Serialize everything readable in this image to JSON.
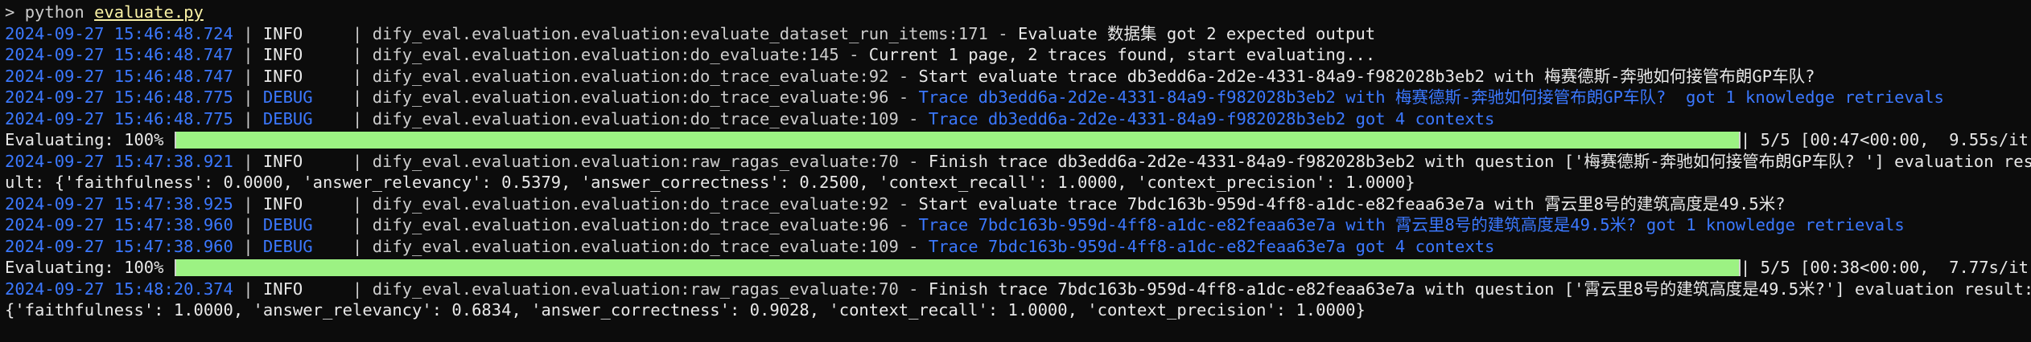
{
  "terminal": {
    "prompt": "> ",
    "command": "python",
    "argument": "evaluate.py"
  },
  "lines": [
    {
      "kind": "log",
      "ts": "2024-09-27 15:46:48.724",
      "level": "INFO",
      "loc": "dify_eval.evaluation.evaluation:evaluate_dataset_run_items:171",
      "msg": "Evaluate 数据集 got 2 expected output"
    },
    {
      "kind": "log",
      "ts": "2024-09-27 15:46:48.747",
      "level": "INFO",
      "loc": "dify_eval.evaluation.evaluation:do_evaluate:145",
      "msg": "Current 1 page, 2 traces found, start evaluating..."
    },
    {
      "kind": "log",
      "ts": "2024-09-27 15:46:48.747",
      "level": "INFO",
      "loc": "dify_eval.evaluation.evaluation:do_trace_evaluate:92",
      "msg": "Start evaluate trace db3edd6a-2d2e-4331-84a9-f982028b3eb2 with 梅赛德斯-奔驰如何接管布朗GP车队?"
    },
    {
      "kind": "log",
      "ts": "2024-09-27 15:46:48.775",
      "level": "DEBUG",
      "loc": "dify_eval.evaluation.evaluation:do_trace_evaluate:96",
      "msg": "Trace db3edd6a-2d2e-4331-84a9-f982028b3eb2 with 梅赛德斯-奔驰如何接管布朗GP车队?  got 1 knowledge retrievals"
    },
    {
      "kind": "log",
      "ts": "2024-09-27 15:46:48.775",
      "level": "DEBUG",
      "loc": "dify_eval.evaluation.evaluation:do_trace_evaluate:109",
      "msg": "Trace db3edd6a-2d2e-4331-84a9-f982028b3eb2 got 4 contexts"
    },
    {
      "kind": "progress",
      "label": "Evaluating: 100%",
      "fraction": 1.0,
      "stats": "| 5/5 [00:47<00:00,  9.55s/it]"
    },
    {
      "kind": "log",
      "ts": "2024-09-27 15:47:38.921",
      "level": "INFO",
      "loc": "dify_eval.evaluation.evaluation:raw_ragas_evaluate:70",
      "msg": "Finish trace db3edd6a-2d2e-4331-84a9-f982028b3eb2 with question ['梅赛德斯-奔驰如何接管布朗GP车队? '] evaluation res"
    },
    {
      "kind": "wrap",
      "text": "ult: {'faithfulness': 0.0000, 'answer_relevancy': 0.5379, 'answer_correctness': 0.2500, 'context_recall': 1.0000, 'context_precision': 1.0000}"
    },
    {
      "kind": "log",
      "ts": "2024-09-27 15:47:38.925",
      "level": "INFO",
      "loc": "dify_eval.evaluation.evaluation:do_trace_evaluate:92",
      "msg": "Start evaluate trace 7bdc163b-959d-4ff8-a1dc-e82feaa63e7a with 霄云里8号的建筑高度是49.5米?"
    },
    {
      "kind": "log",
      "ts": "2024-09-27 15:47:38.960",
      "level": "DEBUG",
      "loc": "dify_eval.evaluation.evaluation:do_trace_evaluate:96",
      "msg": "Trace 7bdc163b-959d-4ff8-a1dc-e82feaa63e7a with 霄云里8号的建筑高度是49.5米? got 1 knowledge retrievals"
    },
    {
      "kind": "log",
      "ts": "2024-09-27 15:47:38.960",
      "level": "DEBUG",
      "loc": "dify_eval.evaluation.evaluation:do_trace_evaluate:109",
      "msg": "Trace 7bdc163b-959d-4ff8-a1dc-e82feaa63e7a got 4 contexts"
    },
    {
      "kind": "progress",
      "label": "Evaluating: 100%",
      "fraction": 1.0,
      "stats": "| 5/5 [00:38<00:00,  7.77s/it]"
    },
    {
      "kind": "log",
      "ts": "2024-09-27 15:48:20.374",
      "level": "INFO",
      "loc": "dify_eval.evaluation.evaluation:raw_ragas_evaluate:70",
      "msg": "Finish trace 7bdc163b-959d-4ff8-a1dc-e82feaa63e7a with question ['霄云里8号的建筑高度是49.5米?'] evaluation result:"
    },
    {
      "kind": "wrap",
      "text": "{'faithfulness': 1.0000, 'answer_relevancy': 0.6834, 'answer_correctness': 0.9028, 'context_recall': 1.0000, 'context_precision': 1.0000}"
    }
  ],
  "colors": {
    "background": "#0c0c0c",
    "timestamp": "#3b78ff",
    "debug": "#3b78ff",
    "info": "#e8e8e8",
    "progress_fill": "#9cf283",
    "argument": "#f9f1a5"
  }
}
